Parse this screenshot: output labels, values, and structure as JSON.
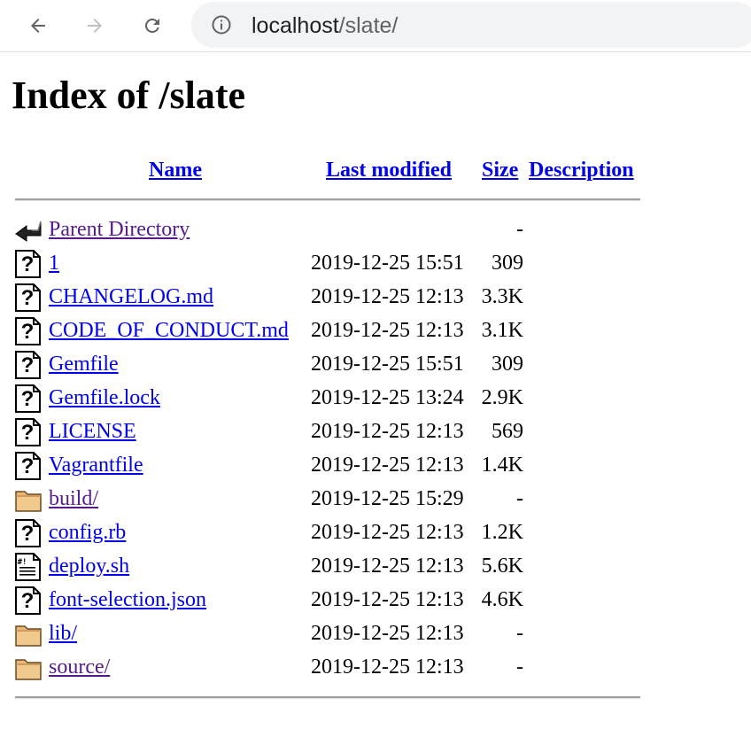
{
  "browser": {
    "url_host": "localhost",
    "url_path": "/slate/"
  },
  "page": {
    "title": "Index of /slate",
    "columns": {
      "name": "Name",
      "last_modified": "Last modified",
      "size": "Size",
      "description": "Description"
    },
    "rows": [
      {
        "name": "Parent Directory",
        "date": "",
        "size": "-",
        "icon": "back-icon",
        "visited": true
      },
      {
        "name": "1",
        "date": "2019-12-25 15:51",
        "size": "309",
        "icon": "unknown-file-icon",
        "visited": false
      },
      {
        "name": "CHANGELOG.md",
        "date": "2019-12-25 12:13",
        "size": "3.3K",
        "icon": "unknown-file-icon",
        "visited": false
      },
      {
        "name": "CODE_OF_CONDUCT.md",
        "date": "2019-12-25 12:13",
        "size": "3.1K",
        "icon": "unknown-file-icon",
        "visited": false
      },
      {
        "name": "Gemfile",
        "date": "2019-12-25 15:51",
        "size": "309",
        "icon": "unknown-file-icon",
        "visited": false
      },
      {
        "name": "Gemfile.lock",
        "date": "2019-12-25 13:24",
        "size": "2.9K",
        "icon": "unknown-file-icon",
        "visited": false
      },
      {
        "name": "LICENSE",
        "date": "2019-12-25 12:13",
        "size": "569",
        "icon": "unknown-file-icon",
        "visited": false
      },
      {
        "name": "Vagrantfile",
        "date": "2019-12-25 12:13",
        "size": "1.4K",
        "icon": "unknown-file-icon",
        "visited": false
      },
      {
        "name": "build/",
        "date": "2019-12-25 15:29",
        "size": "-",
        "icon": "folder-icon",
        "visited": true
      },
      {
        "name": "config.rb",
        "date": "2019-12-25 12:13",
        "size": "1.2K",
        "icon": "unknown-file-icon",
        "visited": false
      },
      {
        "name": "deploy.sh",
        "date": "2019-12-25 12:13",
        "size": "5.6K",
        "icon": "script-file-icon",
        "visited": false
      },
      {
        "name": "font-selection.json",
        "date": "2019-12-25 12:13",
        "size": "4.6K",
        "icon": "unknown-file-icon",
        "visited": false
      },
      {
        "name": "lib/",
        "date": "2019-12-25 12:13",
        "size": "-",
        "icon": "folder-icon",
        "visited": false
      },
      {
        "name": "source/",
        "date": "2019-12-25 12:13",
        "size": "-",
        "icon": "folder-icon",
        "visited": true
      }
    ]
  }
}
